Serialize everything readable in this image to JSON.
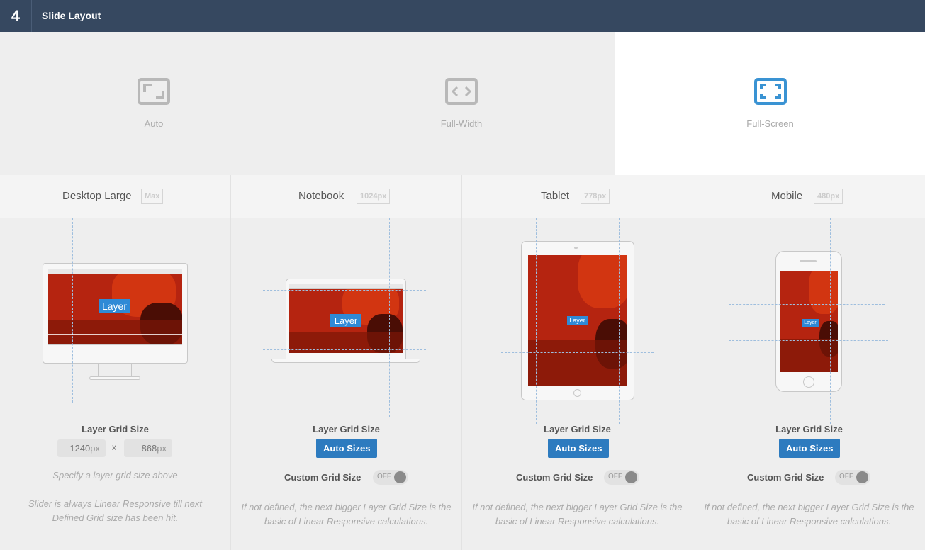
{
  "header": {
    "step": "4",
    "title": "Slide Layout"
  },
  "layouts": [
    {
      "label": "Auto",
      "selected": false
    },
    {
      "label": "Full-Width",
      "selected": false
    },
    {
      "label": "Full-Screen",
      "selected": true
    }
  ],
  "devices": [
    {
      "name": "Desktop Large",
      "badge": "Max",
      "layer": "Layer",
      "grid_label": "Layer Grid Size",
      "width_value": "1240",
      "height_value": "868",
      "unit": "px",
      "separator": "x",
      "hint1": "Specify a layer grid size above",
      "hint2": "Slider is always Linear Responsive till next Defined Grid size has been hit."
    },
    {
      "name": "Notebook",
      "badge": "1024px",
      "layer": "Layer",
      "grid_label": "Layer Grid Size",
      "button": "Auto Sizes",
      "custom_label": "Custom Grid Size",
      "toggle": "OFF",
      "hint": "If not defined, the next bigger Layer Grid Size is the basic of Linear Responsive calculations."
    },
    {
      "name": "Tablet",
      "badge": "778px",
      "layer": "Layer",
      "grid_label": "Layer Grid Size",
      "button": "Auto Sizes",
      "custom_label": "Custom Grid Size",
      "toggle": "OFF",
      "hint": "If not defined, the next bigger Layer Grid Size is the basic of Linear Responsive calculations."
    },
    {
      "name": "Mobile",
      "badge": "480px",
      "layer": "Layer",
      "grid_label": "Layer Grid Size",
      "button": "Auto Sizes",
      "custom_label": "Custom Grid Size",
      "toggle": "OFF",
      "hint": "If not defined, the next bigger Layer Grid Size is the basic of Linear Responsive calculations."
    }
  ],
  "colors": {
    "header_bg": "#364860",
    "accent": "#2d7bbf",
    "icon_selected": "#3a93d3",
    "icon_idle": "#b8b8b8"
  },
  "icons": {
    "auto": "auto-layout-icon",
    "fullwidth": "fullwidth-layout-icon",
    "fullscreen": "fullscreen-layout-icon"
  }
}
